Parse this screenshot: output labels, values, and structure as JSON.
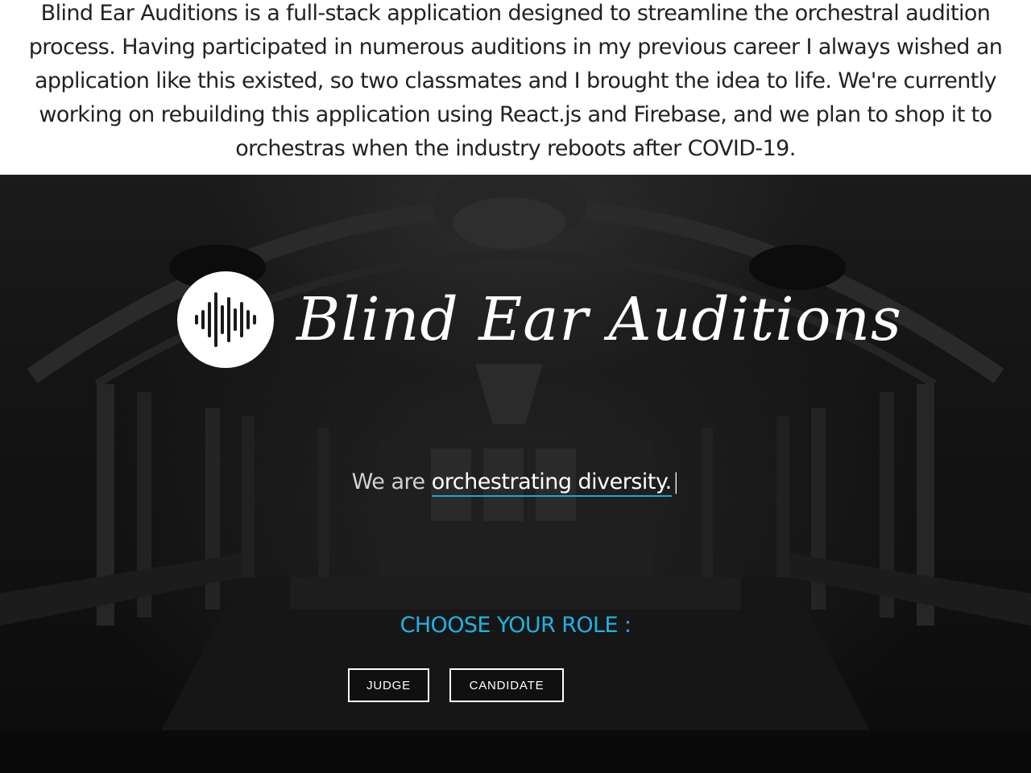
{
  "caption": {
    "text": "Blind Ear Auditions is a full-stack application designed to streamline the orchestral audition process.  Having participated in numerous auditions in my previous career I always wished an application like this existed, so two classmates and I brought the idea to life. We're currently working on rebuilding this application using React.js and Firebase, and we plan to shop it to orchestras when the industry reboots after COVID-19."
  },
  "hero": {
    "logo": {
      "icon": "soundwave-icon",
      "text": "Blind Ear Auditions"
    },
    "tagline": {
      "prefix": "We are",
      "highlight": "orchestrating diversity.",
      "cursor": "|"
    },
    "role_prompt": "CHOOSE YOUR ROLE :",
    "buttons": {
      "judge": "JUDGE",
      "candidate": "CANDIDATE"
    }
  },
  "colors": {
    "accent": "#1fb3e3",
    "underline": "#1ea8d8",
    "background": "#111111"
  }
}
